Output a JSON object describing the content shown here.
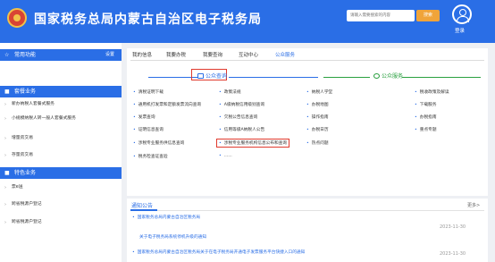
{
  "header": {
    "site_title": "国家税务总局内蒙古自治区电子税务局",
    "search_placeholder": "请输入需要搜索的内容",
    "search_button": "搜索",
    "login_label": "登录"
  },
  "sidebar": {
    "common_head": "常用功能",
    "settings_label": "设置",
    "tax_head": "套餐业务",
    "tax_items": [
      "新办纳税人套餐式服务",
      "小规模纳税人转一般人套餐式服务",
      "增量房交易",
      "存量房交易"
    ],
    "special_head": "特色业务",
    "special_items": [
      "票e送",
      "跨省税源户登记",
      "跨省税源户登记"
    ]
  },
  "tabs": [
    "我的信息",
    "我要办税",
    "我要查询",
    "互动中心",
    "公众服务"
  ],
  "public_query": {
    "title": "公众查询",
    "col1": [
      "清税证明下载",
      "通用机打发票和定额发票流向查询",
      "发票查询",
      "证明信息查询",
      "涉税专业服务供信息查询",
      "税务检查证查验"
    ],
    "col2": [
      "政策法规",
      "A级纳税信用级别查询",
      "欠税公告信息查询",
      "信用等级A纳税人公告",
      "涉税专业服务机构信息公布和查询",
      "......"
    ]
  },
  "public_help": {
    "title": "公众服务",
    "col1": [
      "纳税人学堂",
      "办税地图",
      "操作指南",
      "办税日历",
      "热点问题"
    ],
    "col2": [
      "税收政策及解读",
      "下载服务",
      "办税指南",
      "重点专题"
    ]
  },
  "notice": {
    "title": "通知公告",
    "more": "更多>",
    "items": [
      {
        "source": "国家税务总局内蒙古自治区税务局",
        "text": "关于电子税务局系统停机升级的通知",
        "date": "2023-11-30"
      },
      {
        "source": "国家税务总局内蒙古自治区税务局关于在电子税务局开通电子发票服务平台快捷入口的通知",
        "text": "",
        "date": "2023-11-30"
      }
    ]
  },
  "colors": {
    "brand": "#2a6ee6",
    "highlight": "#e03a2e",
    "help_green": "#2aa040"
  }
}
